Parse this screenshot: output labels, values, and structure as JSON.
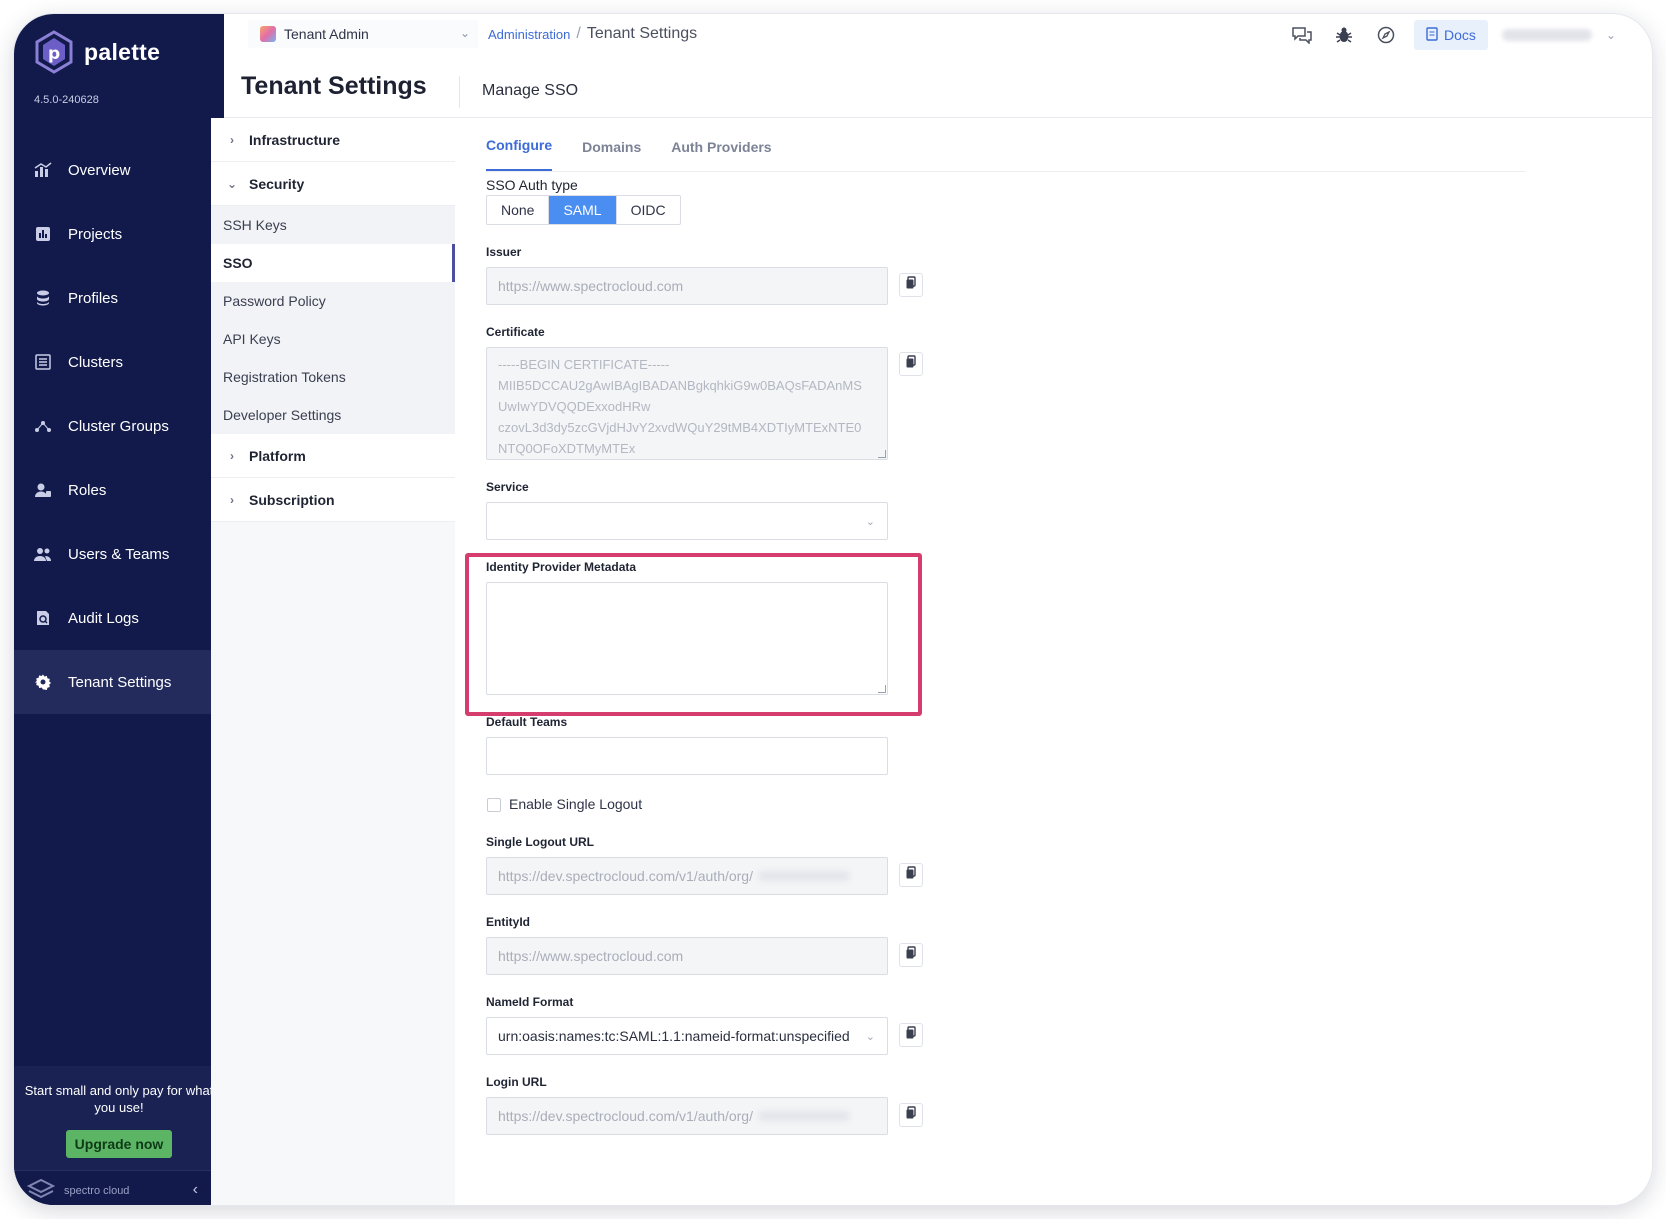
{
  "app": {
    "brand": "palette",
    "version": "4.5.0-240628"
  },
  "sidebar": {
    "items": [
      {
        "label": "Overview",
        "icon": "chart-icon"
      },
      {
        "label": "Projects",
        "icon": "projects-icon"
      },
      {
        "label": "Profiles",
        "icon": "stack-icon"
      },
      {
        "label": "Clusters",
        "icon": "clusters-icon"
      },
      {
        "label": "Cluster Groups",
        "icon": "network-icon"
      },
      {
        "label": "Roles",
        "icon": "roles-icon"
      },
      {
        "label": "Users & Teams",
        "icon": "users-icon"
      },
      {
        "label": "Audit Logs",
        "icon": "audit-icon"
      },
      {
        "label": "Tenant Settings",
        "icon": "gear-icon",
        "active": true
      }
    ],
    "promo_text": "Start small and only pay for what you use!",
    "upgrade_label": "Upgrade now",
    "footer_brand": "spectro cloud"
  },
  "topbar": {
    "tenant_label": "Tenant Admin",
    "breadcrumb_parent": "Administration",
    "breadcrumb_sep": "/",
    "breadcrumb_current": "Tenant Settings",
    "docs_label": "Docs"
  },
  "page": {
    "title": "Tenant Settings",
    "subtitle": "Manage SSO"
  },
  "menu": {
    "infrastructure": "Infrastructure",
    "security": "Security",
    "security_items": [
      "SSH Keys",
      "SSO",
      "Password Policy",
      "API Keys",
      "Registration Tokens",
      "Developer Settings"
    ],
    "platform": "Platform",
    "subscription": "Subscription"
  },
  "tabs": [
    "Configure",
    "Domains",
    "Auth Providers"
  ],
  "form": {
    "auth_type_label": "SSO Auth type",
    "auth_types": [
      "None",
      "SAML",
      "OIDC"
    ],
    "auth_type_selected": "SAML",
    "issuer_label": "Issuer",
    "issuer_value": "https://www.spectrocloud.com",
    "certificate_label": "Certificate",
    "certificate_lines": [
      "-----BEGIN CERTIFICATE-----",
      "MIIB5DCCAU2gAwIBAgIBADANBgkqhkiG9w0BAQsFADAnMS",
      "UwIwYDVQQDExxodHRw",
      "czovL3d3dy5zcGVjdHJvY2xvdWQuY29tMB4XDTIyMTExNTE0",
      "NTQ0OFoXDTMyMTEx"
    ],
    "service_label": "Service",
    "service_value": "",
    "idp_metadata_label": "Identity Provider Metadata",
    "idp_metadata_value": "",
    "default_teams_label": "Default Teams",
    "default_teams_value": "",
    "single_logout_label": "Enable Single Logout",
    "single_logout_checked": false,
    "slo_url_label": "Single Logout URL",
    "slo_url_value": "https://dev.spectrocloud.com/v1/auth/org/",
    "entity_id_label": "EntityId",
    "entity_id_value": "https://www.spectrocloud.com",
    "nameid_label": "NameId Format",
    "nameid_value": "urn:oasis:names:tc:SAML:1.1:nameid-format:unspecified",
    "login_url_label": "Login URL",
    "login_url_value": "https://dev.spectrocloud.com/v1/auth/org/"
  },
  "colors": {
    "sidebar_bg": "#121a4b",
    "accent": "#3d6bd8",
    "selected_segment": "#4b8ef1",
    "highlight_box": "#d43d6e",
    "upgrade_green": "#5cb565"
  }
}
